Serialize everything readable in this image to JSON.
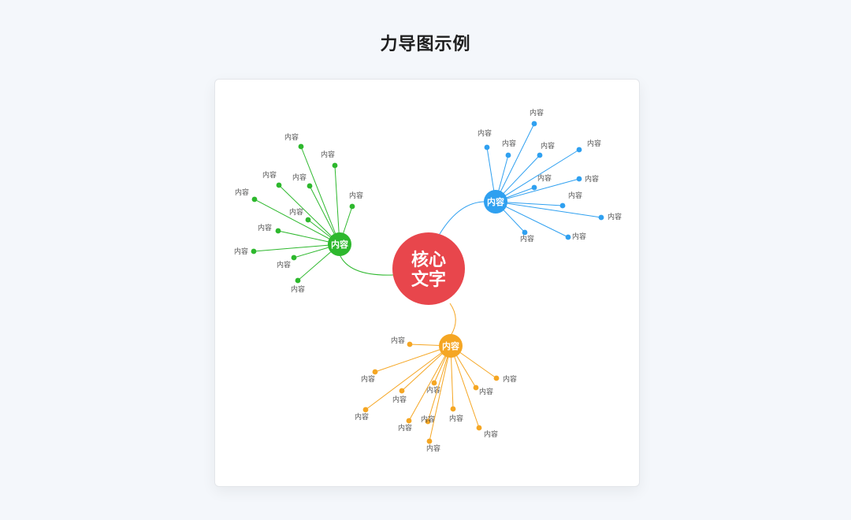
{
  "page": {
    "title": "力导图示例"
  },
  "core": {
    "lines": [
      "核心",
      "文字"
    ],
    "color": "#e8464c"
  },
  "branches": [
    {
      "name": "green",
      "label": "内容",
      "color": "#2db82d",
      "leaves": [
        "内容",
        "内容",
        "内容",
        "内容",
        "内容",
        "内容",
        "内容",
        "内容",
        "内容",
        "内容",
        "内容"
      ]
    },
    {
      "name": "blue",
      "label": "内容",
      "color": "#2fa0f0",
      "leaves": [
        "内容",
        "内容",
        "内容",
        "内容",
        "内容",
        "内容",
        "内容",
        "内容",
        "内容",
        "内容",
        "内容"
      ]
    },
    {
      "name": "orange",
      "label": "内容",
      "color": "#f5a623",
      "leaves": [
        "内容",
        "内容",
        "内容",
        "内容",
        "内容",
        "内容",
        "内容",
        "内容",
        "内容",
        "内容",
        "内容",
        "内容"
      ]
    }
  ]
}
